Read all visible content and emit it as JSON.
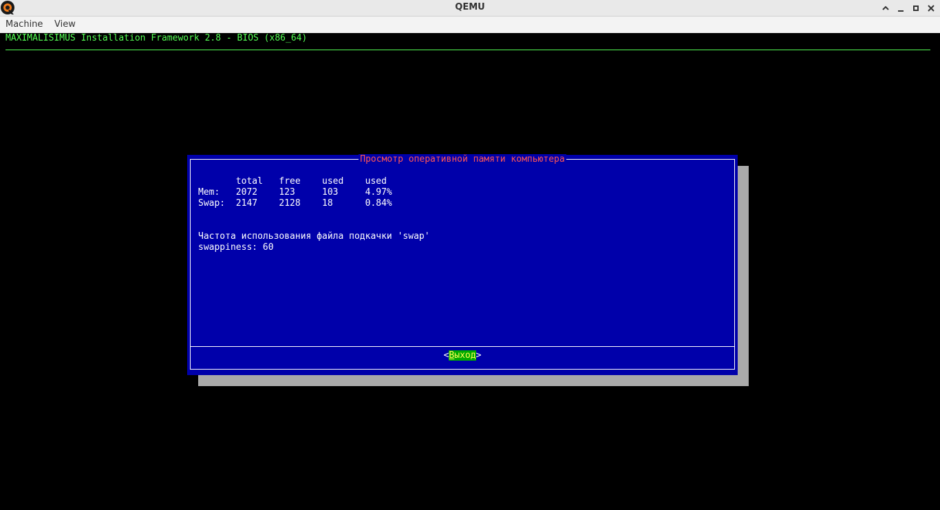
{
  "window": {
    "title": "QEMU",
    "buttons": {
      "maximize": "^",
      "minimize": "_",
      "restore": "▫",
      "close": "×"
    }
  },
  "menu": {
    "items": [
      "Machine",
      "View"
    ]
  },
  "console": {
    "backtitle": "MAXIMALISIMUS Installation Framework 2.8 - BIOS (x86_64)",
    "dialog": {
      "title": "Просмотр оперативной памяти компьютера",
      "lines": [
        "       total   free    used    used",
        "Mem:   2072    123     103     4.97%",
        "Swap:  2147    2128    18      0.84%",
        "",
        "",
        "Частота использования файла подкачки 'swap'",
        "swappiness: 60"
      ],
      "button": {
        "left": "<",
        "hotkey": "В",
        "rest": "ыход",
        "right": ">"
      }
    }
  },
  "colors": {
    "dialog_bg": "#0000aa",
    "shadow": "#aaaaaa",
    "title_fg": "#ff5555",
    "backtitle_fg": "#54ff54",
    "button_bg": "#00aa00",
    "button_fg": "#ffff55"
  }
}
